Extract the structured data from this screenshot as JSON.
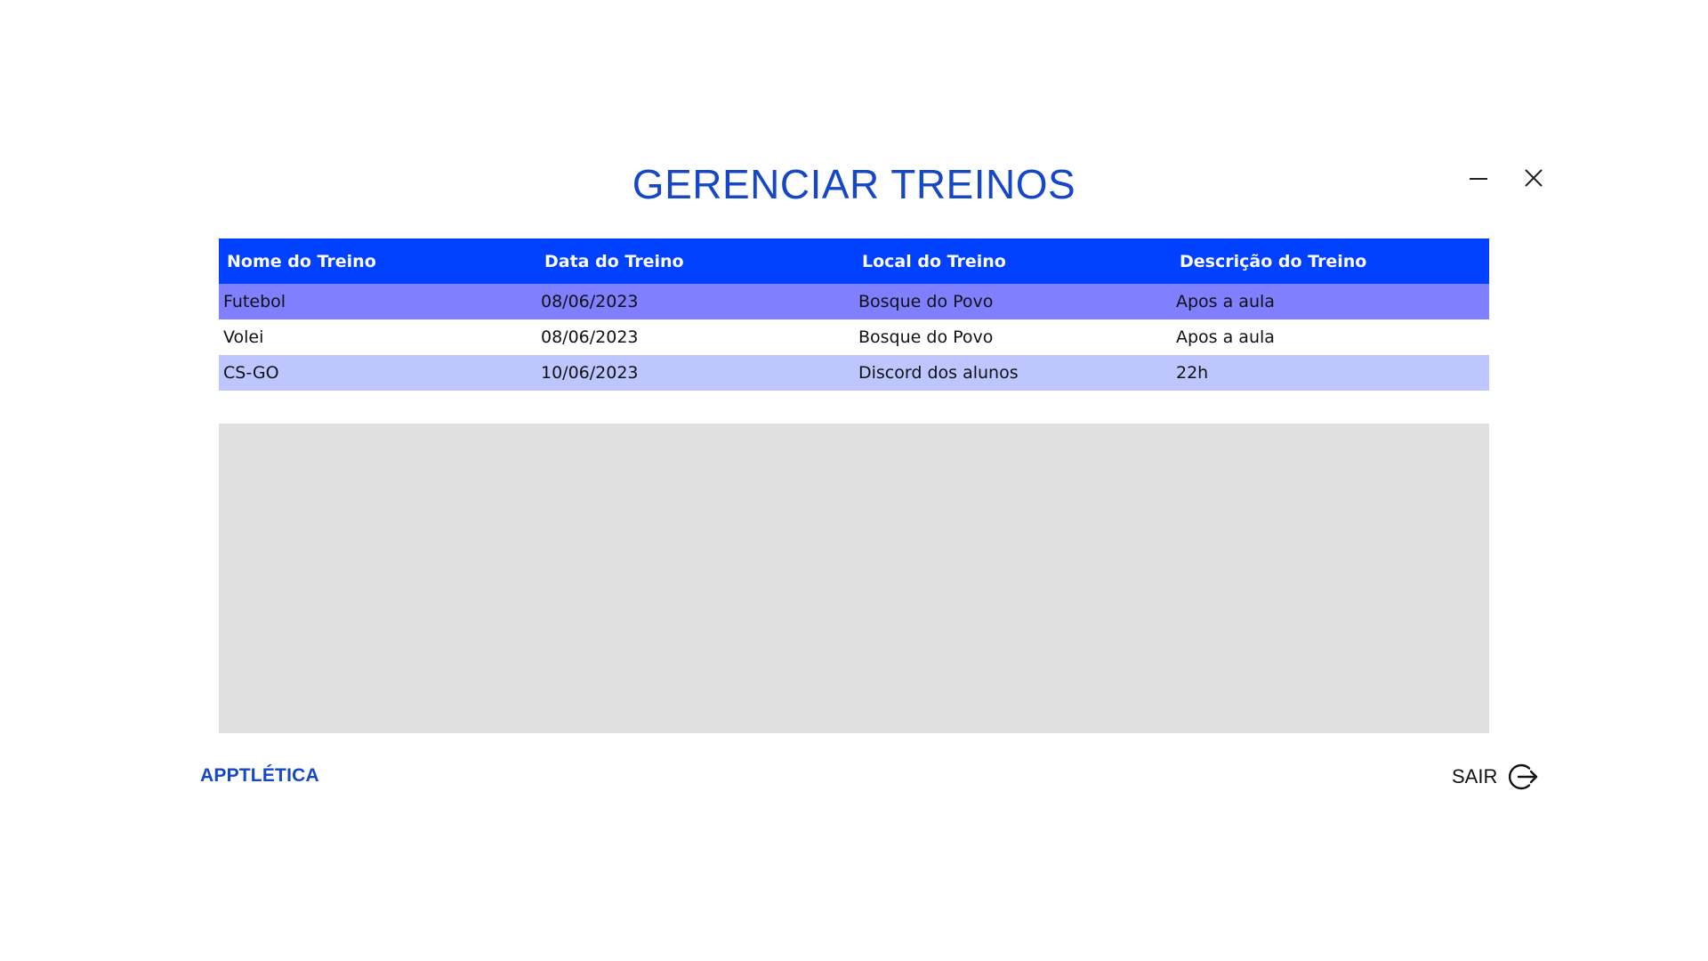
{
  "window": {
    "title": "GERENCIAR TREINOS"
  },
  "controls": {
    "minimize_icon": "minimize-icon",
    "close_icon": "close-icon"
  },
  "table": {
    "columns": [
      "Nome do Treino",
      "Data do Treino",
      "Local do Treino",
      "Descrição do Treino"
    ],
    "rows": [
      {
        "nome": "Futebol",
        "data": "08/06/2023",
        "local": "Bosque do Povo",
        "descricao": "Apos a aula",
        "state": "selected"
      },
      {
        "nome": "Volei",
        "data": "08/06/2023",
        "local": "Bosque do Povo",
        "descricao": "Apos a aula",
        "state": "plain"
      },
      {
        "nome": "CS-GO",
        "data": "10/06/2023",
        "local": "Discord dos alunos",
        "descricao": "22h",
        "state": "alt"
      }
    ]
  },
  "footer": {
    "brand": "APPTLÉTICA",
    "exit_label": "SAIR",
    "exit_icon": "logout-icon"
  },
  "colors": {
    "accent": "#1547c6",
    "header_bg": "#0040ff",
    "selected_row": "#7f7fff",
    "alt_row": "#bdc6ff",
    "panel": "#e0e0e0"
  }
}
